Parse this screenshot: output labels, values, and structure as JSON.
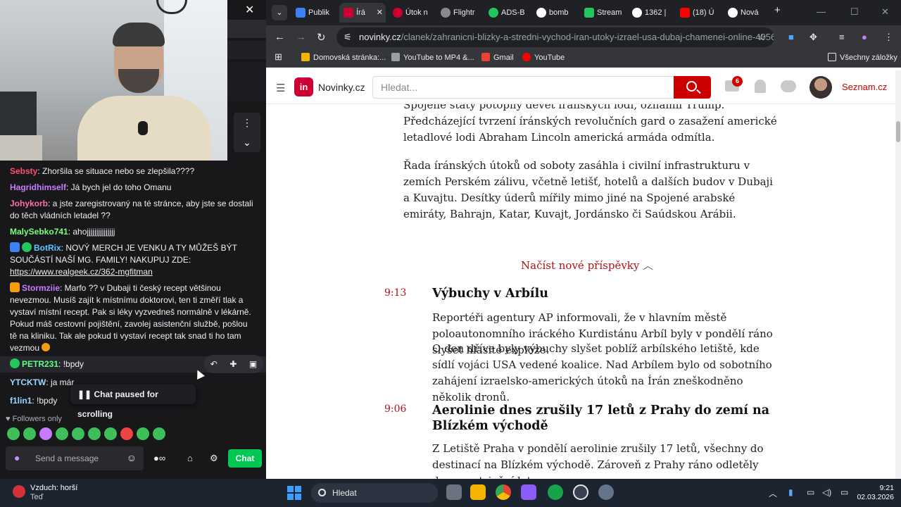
{
  "chat": {
    "messages": [
      {
        "user": "Sebsty",
        "color": "#ff4f6d",
        "text": ": Zhoršila se situace nebo se zlepšila????"
      },
      {
        "user": "Hagridhimself",
        "color": "#c87bff",
        "text": ": Já bych jel do toho Omanu"
      },
      {
        "user": "Johykorb",
        "color": "#ff6fa8",
        "text": ": a jste zaregistrovaný na té stránce, aby jste se dostali do těch vládních letadel ??"
      },
      {
        "user": "MalySebko741",
        "color": "#7cff7c",
        "text": ": ahojjjjjjjjjjjjjjj"
      },
      {
        "user": "BotRix",
        "color": "#5cc8ff",
        "text": ": NOVÝ MERCH JE VENKU A TY MŮŽEŠ BÝT SOUČÁSTÍ NAŠÍ MG. FAMILY! NAKUPUJ ZDE: ",
        "link": "https://www.realgeek.cz/362-mgfitman"
      },
      {
        "user": "Stormziie",
        "color": "#c87bff",
        "text": ": Marfo ?? v Dubaji ti český recept většinou nevezmou. Musíš zajít k místnímu doktorovi, ten ti změří tlak a vystaví místní recept. Pak si léky vyzvedneš normálně v lékárně. Pokud máš cestovní pojištění, zavolej asistenční službě, pošlou tě na kliniku. Tak ale pokud ti vystaví recept tak snad ti ho tam vezmou"
      },
      {
        "user": "PETR231",
        "color": "#5cff8a",
        "text": ": !bpdy"
      },
      {
        "user": "YTCKTW",
        "color": "#9ad7ff",
        "text": ": ja már"
      },
      {
        "user": "f1lin1",
        "color": "#9ad7ff",
        "text": ": !bpdy"
      }
    ],
    "paused_label": "Chat paused for scrolling",
    "followers_label": "Followers only",
    "input_placeholder": "Send a message",
    "chat_button": "Chat"
  },
  "browser": {
    "tabs": [
      {
        "label": "Publik",
        "color": "#3b82f6"
      },
      {
        "label": "Írá",
        "color": "#cc0033",
        "active": true
      },
      {
        "label": "Útok n",
        "color": "#cc0033"
      },
      {
        "label": "Flightr",
        "color": "#8a8a8a"
      },
      {
        "label": "ADS-B",
        "color": "#22c55e"
      },
      {
        "label": "bomb",
        "color": "#ffffff"
      },
      {
        "label": "Stream",
        "color": "#22c55e"
      },
      {
        "label": "1362 |",
        "color": "#ffffff"
      },
      {
        "label": "(18) Ú",
        "color": "#ff0000"
      },
      {
        "label": "Nová",
        "color": "#ffffff"
      }
    ],
    "url_host": "novinky.cz",
    "url_path": "/clanek/zahranicni-blizky-a-stredni-vychod-iran-utoky-izrael-usa-dubaj-chamenei-online-40564...",
    "bookmarks": [
      {
        "label": "Domovská stránka:...",
        "color": "#f4b400"
      },
      {
        "label": "YouTube to MP4 &...",
        "color": "#9aa0a6"
      },
      {
        "label": "Gmail",
        "color": "#ea4335"
      },
      {
        "label": "YouTube",
        "color": "#ff0000"
      }
    ],
    "all_bookmarks": "Všechny záložky"
  },
  "site": {
    "logo_mark": "in",
    "logo_text": "Novinky.cz",
    "search_placeholder": "Hledat...",
    "mail_count": "6",
    "seznam": "Seznam.cz"
  },
  "article": {
    "para1": "Spojené státy potopily devět íránských lodí, oznámil Trump. Předcházející tvrzení íránských revolučních gard o zasažení americké letadlové lodi Abraham Lincoln americká armáda odmítla.",
    "para2": "Řada íránských útoků od soboty zasáhla i civilní infrastrukturu v zemích Perském zálivu, včetně letišť, hotelů a dalších budov v Dubaji a Kuvajtu. Desítky úderů mířily mimo jiné na Spojené arabské emiráty, Bahrajn, Katar, Kuvajt, Jordánsko či Saúdskou Arábii.",
    "load_more": "Načíst nové příspěvky",
    "entries": [
      {
        "time": "9:13",
        "title": "Výbuchy v Arbílu",
        "body": "Reportéři agentury AP informovali, že v hlavním městě poloautonomního iráckého Kurdistánu Arbíl byly v pondělí ráno slyšet hlasité exploze.",
        "body2": "O den dříve byly výbuchy slyšet poblíž arbílského letiště, kde sídlí vojáci USA vedené koalice. Nad Arbílem bylo od sobotního zahájení izraelsko-amerických útoků na Írán zneškodněno několik dronů."
      },
      {
        "time": "9:06",
        "title": "Aerolinie dnes zrušily 17 letů z Prahy do zemí na Blízkém východě",
        "body": "Z Letiště Praha v pondělí aerolinie zrušily 17 letů, všechny do destinací na Blízkém východě. Zároveň z Prahy ráno odletěly dva repatriační lety pro"
      }
    ]
  },
  "taskbar": {
    "weather_title": "Vzduch: horší",
    "weather_sub": "Teď",
    "search_label": "Hledat",
    "time": "9:21",
    "date": "02.03.2026"
  }
}
